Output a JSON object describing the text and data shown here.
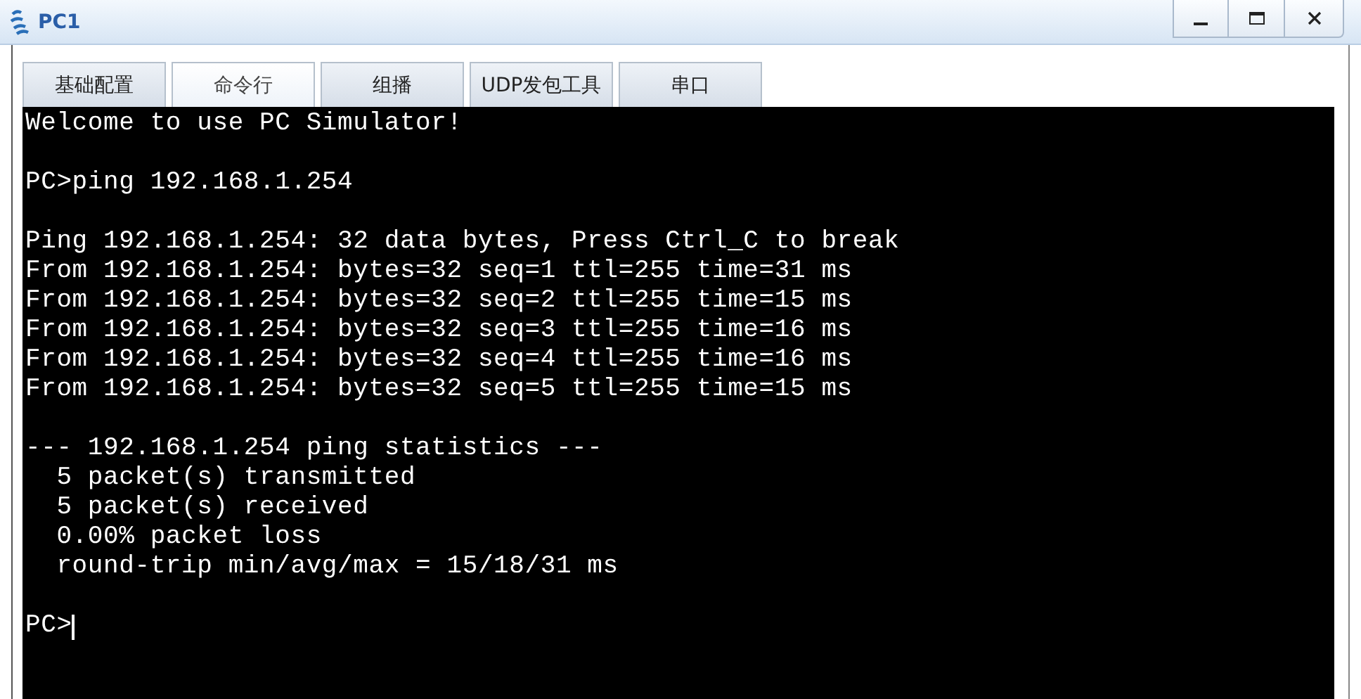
{
  "window": {
    "title": "PC1"
  },
  "tabs": [
    {
      "label": "基础配置",
      "selected": false
    },
    {
      "label": "命令行",
      "selected": true
    },
    {
      "label": "组播",
      "selected": false
    },
    {
      "label": "UDP发包工具",
      "selected": false
    },
    {
      "label": "串口",
      "selected": false
    }
  ],
  "terminal": {
    "blocks": [
      [
        "Welcome to use PC Simulator!"
      ],
      [
        "PC>ping 192.168.1.254"
      ],
      [
        "Ping 192.168.1.254: 32 data bytes, Press Ctrl_C to break",
        "From 192.168.1.254: bytes=32 seq=1 ttl=255 time=31 ms",
        "From 192.168.1.254: bytes=32 seq=2 ttl=255 time=15 ms",
        "From 192.168.1.254: bytes=32 seq=3 ttl=255 time=16 ms",
        "From 192.168.1.254: bytes=32 seq=4 ttl=255 time=16 ms",
        "From 192.168.1.254: bytes=32 seq=5 ttl=255 time=15 ms"
      ],
      [
        "--- 192.168.1.254 ping statistics ---",
        "  5 packet(s) transmitted",
        "  5 packet(s) received",
        "  0.00% packet loss",
        "  round-trip min/avg/max = 15/18/31 ms"
      ]
    ],
    "prompt": "PC>",
    "cursor": true
  }
}
